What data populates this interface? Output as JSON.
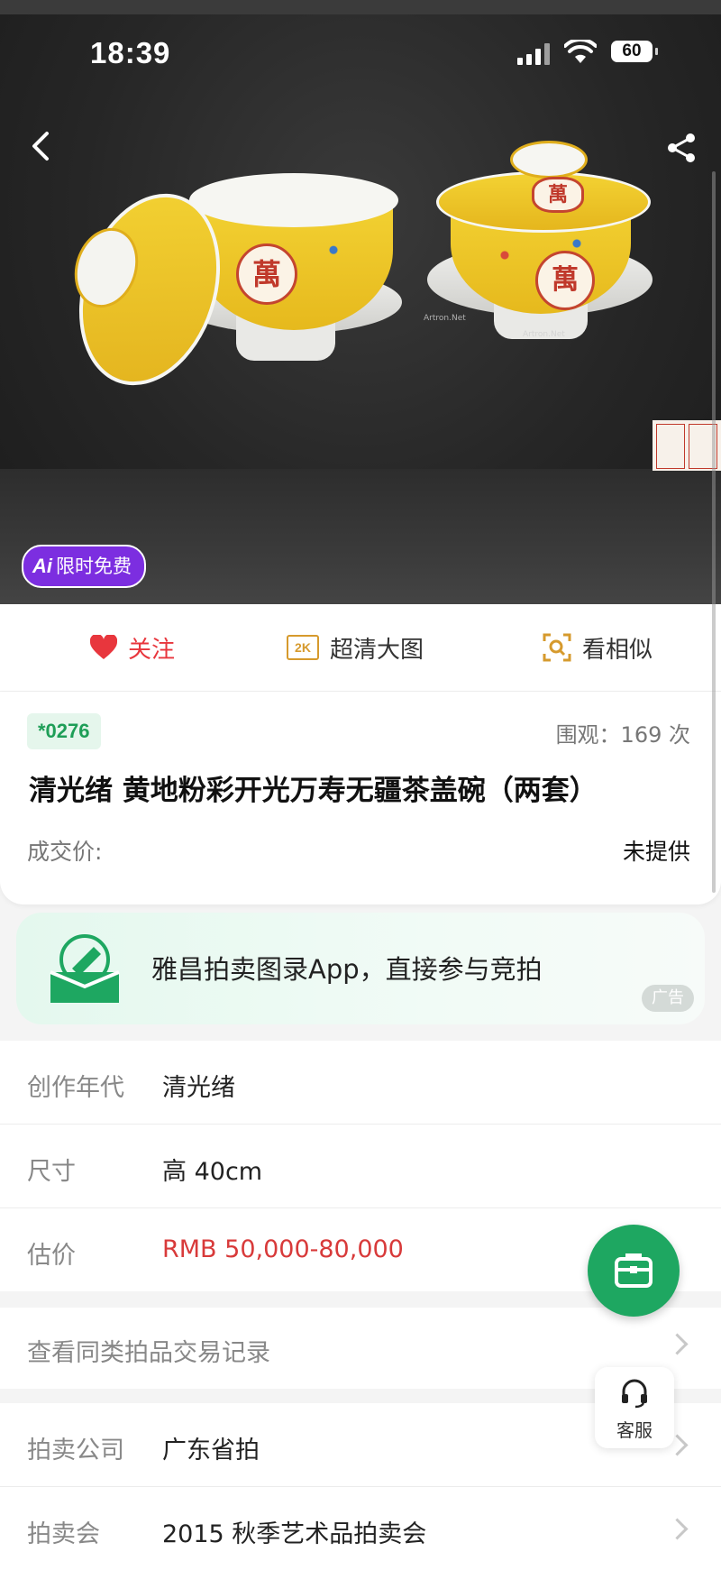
{
  "status_bar": {
    "time": "18:39",
    "battery": "60"
  },
  "hero": {
    "ai_badge_mark": "Ai",
    "ai_badge_label": "限时免费",
    "medal_char": "萬",
    "watermark": "Artron.Net"
  },
  "actions": {
    "follow": "关注",
    "hd_icon": "2K",
    "hd": "超清大图",
    "similar": "看相似"
  },
  "lot": {
    "number": "*0276",
    "views": "围观：169 次",
    "title": "清光绪 黄地粉彩开光万寿无疆茶盖碗（两套）",
    "price_label": "成交价:",
    "price_value": "未提供"
  },
  "ad": {
    "text": "雅昌拍卖图录App，直接参与竞拍",
    "tag": "广告"
  },
  "details": [
    {
      "key": "创作年代",
      "value": "清光绪"
    },
    {
      "key": "尺寸",
      "value": "高 40cm"
    },
    {
      "key": "估价",
      "value": "RMB  50,000-80,000"
    }
  ],
  "records_link": "查看同类拍品交易记录",
  "auction": [
    {
      "key": "拍卖公司",
      "value": "广东省拍"
    },
    {
      "key": "拍卖会",
      "value": "2015 秋季艺术品拍卖会"
    }
  ],
  "service_label": "客服",
  "colors": {
    "accent_green": "#1ea761",
    "price_red": "#d83a3a",
    "follow_red": "#e8363d",
    "ai_purple": "#7c2ee0"
  }
}
